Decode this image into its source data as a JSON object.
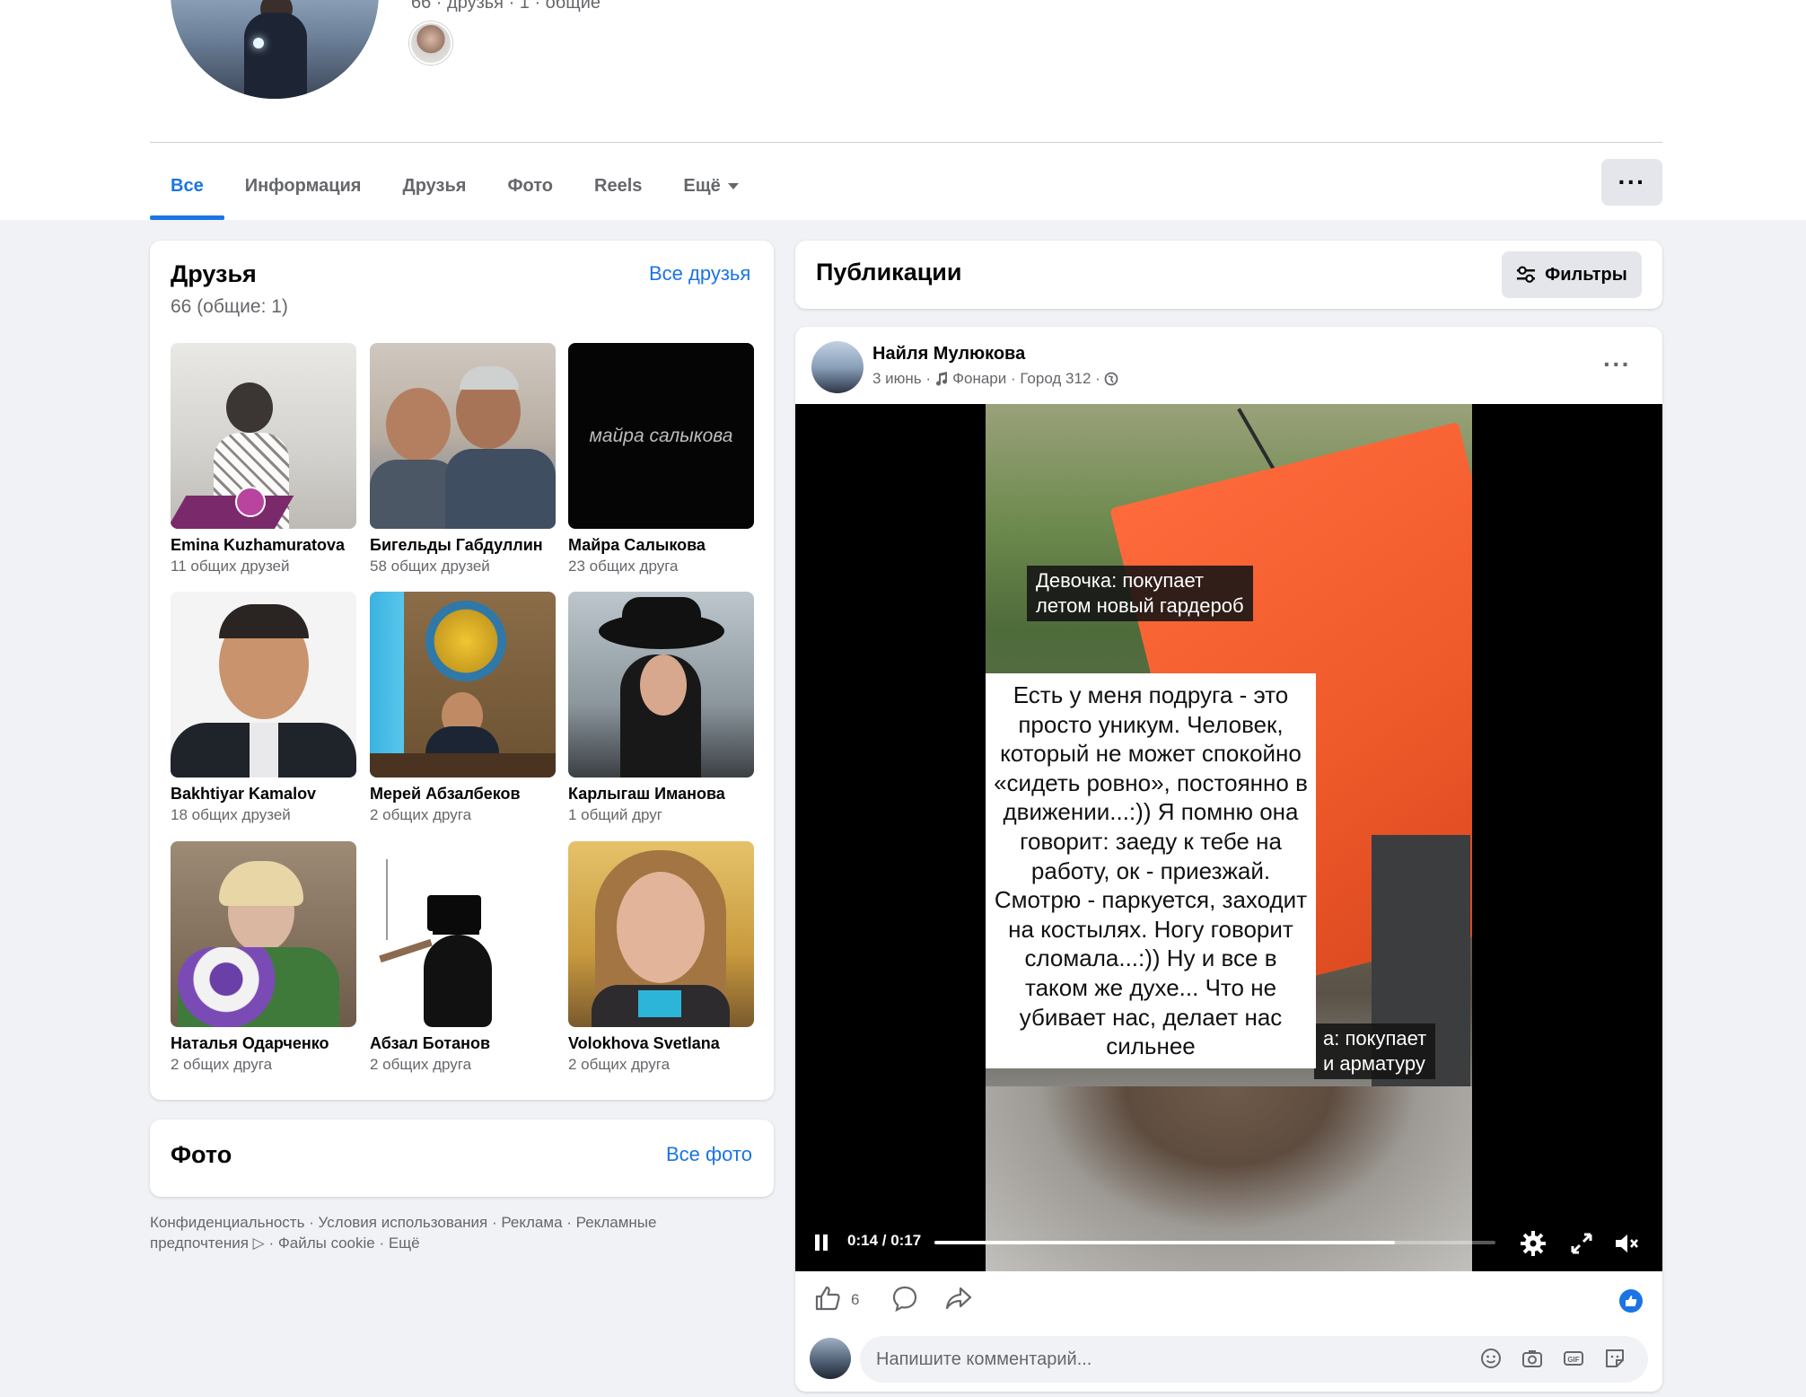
{
  "header": {
    "cut_text": "66 · друзья · 1 · общие",
    "tabs": [
      {
        "label": "Все",
        "active": true
      },
      {
        "label": "Информация",
        "active": false
      },
      {
        "label": "Друзья",
        "active": false
      },
      {
        "label": "Фото",
        "active": false
      },
      {
        "label": "Reels",
        "active": false
      },
      {
        "label": "Ещё",
        "active": false
      }
    ],
    "more_icon": "ellipsis-icon"
  },
  "friends": {
    "title": "Друзья",
    "subtitle": "66 (общие: 1)",
    "all_link": "Все друзья",
    "items": [
      {
        "name": "Emina Kuzhamuratova",
        "mutual": "11 общих друзей"
      },
      {
        "name": "Бигельды Габдуллин",
        "mutual": "58 общих друзей"
      },
      {
        "name": "Майра Салыкова",
        "mutual": "23 общих друга",
        "photo_text": "майра салыкова"
      },
      {
        "name": "Bakhtiyar Kamalov",
        "mutual": "18 общих друзей"
      },
      {
        "name": "Мерей Абзалбеков",
        "mutual": "2 общих друга"
      },
      {
        "name": "Карлыгаш Иманова",
        "mutual": "1 общий друг"
      },
      {
        "name": "Наталья Одарченко",
        "mutual": "2 общих друга"
      },
      {
        "name": "Абзал Ботанов",
        "mutual": "2 общих друга"
      },
      {
        "name": "Volokhova Svetlana",
        "mutual": "2 общих друга"
      }
    ]
  },
  "photos": {
    "title": "Фото",
    "all_link": "Все фото"
  },
  "footer": {
    "line1": "Конфиденциальность · Условия использования · Реклама · Рекламные",
    "line2": "предпочтения ▷ · Файлы cookie · Ещё"
  },
  "publications": {
    "title": "Публикации",
    "filter_label": "Фильтры"
  },
  "post": {
    "author": "Найля Мулюкова",
    "date": "3 июнь ·",
    "music": "Фонари · Город 312 ·",
    "caption_top_1": "Девочка: покупает",
    "caption_top_2": "летом новый гардероб",
    "caption_side_1": "а: покупает",
    "caption_side_2": "и арматуру",
    "main_text": "Есть у меня подруга - это просто уникум. Человек, который не может спокойно «сидеть ровно», постоянно в движении...:)) Я помню она говорит: заеду к тебе на работу, ок - приезжай. Смотрю - паркуется, заходит на костылях. Ногу говорит сломала...:)) Ну и все в таком же духе... Что не убивает нас, делает нас сильнее",
    "time": "0:14 / 0:17",
    "progress": 0.82,
    "likes": "6",
    "comment_placeholder": "Напишите комментарий..."
  },
  "colors": {
    "accent": "#1b74e4",
    "background": "#f0f2f5",
    "card": "#ffffff",
    "secondary_text": "#65676b"
  }
}
